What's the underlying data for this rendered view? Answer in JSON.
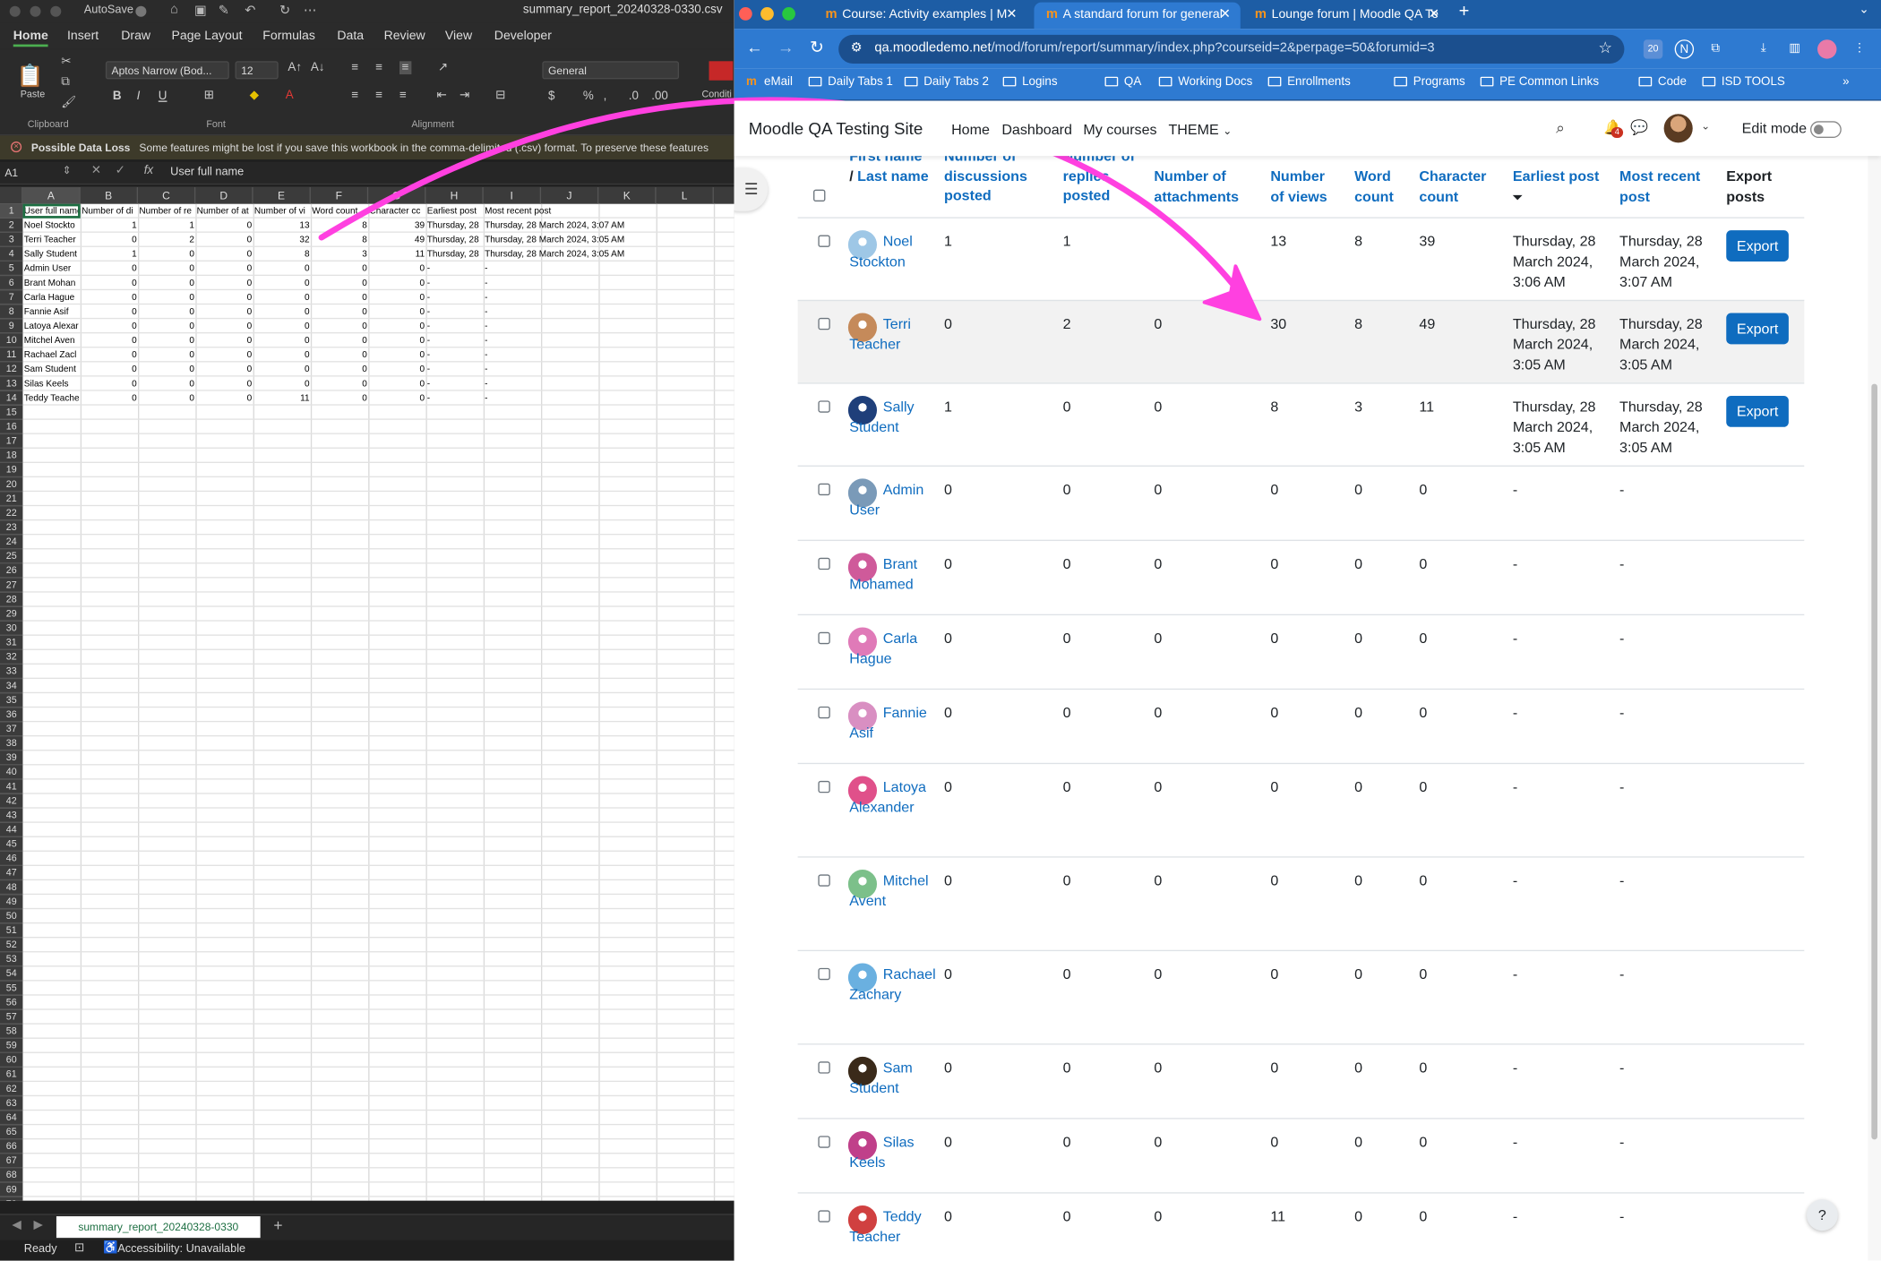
{
  "excel": {
    "autosave_label": "AutoSave",
    "filename": "summary_report_20240328-0330.csv",
    "ribbon_tabs": [
      "Home",
      "Insert",
      "Draw",
      "Page Layout",
      "Formulas",
      "Data",
      "Review",
      "View",
      "Developer"
    ],
    "font_name": "Aptos Narrow (Bod...",
    "font_size": "12",
    "number_format": "General",
    "paste_label": "Paste",
    "cond_label": "Conditi",
    "groups": {
      "clipboard": "Clipboard",
      "font": "Font",
      "alignment": "Alignment"
    },
    "alert_title": "Possible Data Loss",
    "alert_text": "Some features might be lost if you save this workbook in the comma-delimited (.csv) format. To preserve these features",
    "namebox": "A1",
    "formula": "User full name",
    "columns": [
      "A",
      "B",
      "C",
      "D",
      "E",
      "F",
      "G",
      "H",
      "I",
      "J",
      "K",
      "L"
    ],
    "header_row": [
      "User full name",
      "Number of di",
      "Number of re",
      "Number of at",
      "Number of vi",
      "Word count",
      "Character cc",
      "Earliest post",
      "Most recent post"
    ],
    "rows": [
      [
        "Noel Stockto",
        "1",
        "1",
        "0",
        "13",
        "8",
        "39",
        "Thursday, 28",
        "Thursday, 28 March 2024, 3:07 AM"
      ],
      [
        "Terri Teacher",
        "0",
        "2",
        "0",
        "32",
        "8",
        "49",
        "Thursday, 28",
        "Thursday, 28 March 2024, 3:05 AM"
      ],
      [
        "Sally Student",
        "1",
        "0",
        "0",
        "8",
        "3",
        "11",
        "Thursday, 28",
        "Thursday, 28 March 2024, 3:05 AM"
      ],
      [
        "Admin User",
        "0",
        "0",
        "0",
        "0",
        "0",
        "0",
        "-",
        "-"
      ],
      [
        "Brant Mohan",
        "0",
        "0",
        "0",
        "0",
        "0",
        "0",
        "-",
        "-"
      ],
      [
        "Carla Hague",
        "0",
        "0",
        "0",
        "0",
        "0",
        "0",
        "-",
        "-"
      ],
      [
        "Fannie Asif",
        "0",
        "0",
        "0",
        "0",
        "0",
        "0",
        "-",
        "-"
      ],
      [
        "Latoya Alexar",
        "0",
        "0",
        "0",
        "0",
        "0",
        "0",
        "-",
        "-"
      ],
      [
        "Mitchel Aven",
        "0",
        "0",
        "0",
        "0",
        "0",
        "0",
        "-",
        "-"
      ],
      [
        "Rachael Zacl",
        "0",
        "0",
        "0",
        "0",
        "0",
        "0",
        "-",
        "-"
      ],
      [
        "Sam Student",
        "0",
        "0",
        "0",
        "0",
        "0",
        "0",
        "-",
        "-"
      ],
      [
        "Silas Keels",
        "0",
        "0",
        "0",
        "0",
        "0",
        "0",
        "-",
        "-"
      ],
      [
        "Teddy Teache",
        "0",
        "0",
        "0",
        "11",
        "0",
        "0",
        "-",
        "-"
      ]
    ],
    "sheet_tab": "summary_report_20240328-0330",
    "status_ready": "Ready",
    "status_accessibility": "Accessibility: Unavailable"
  },
  "browser": {
    "tabs": [
      {
        "title": "Course: Activity examples | M"
      },
      {
        "title": "A standard forum for general"
      },
      {
        "title": "Lounge forum | Moodle QA Te"
      }
    ],
    "favicon_glyph": "m",
    "url_host": "qa.moodledemo.net",
    "url_path": "/mod/forum/report/summary/index.php?courseid=2&perpage=50&forumid=3",
    "ext_badge": "20",
    "bookmarks": [
      "eMail",
      "Daily Tabs 1",
      "Daily Tabs 2",
      "Logins",
      "QA",
      "Working Docs",
      "Enrollments",
      "Programs",
      "PE Common Links",
      "Code",
      "ISD TOOLS"
    ]
  },
  "moodle": {
    "site_name": "Moodle QA Testing Site",
    "nav": [
      "Home",
      "Dashboard",
      "My courses",
      "THEME"
    ],
    "notification_count": "4",
    "edit_mode_label": "Edit mode",
    "headers": {
      "first_name": "First name",
      "slash": "/ ",
      "last_name": "Last name",
      "discussions": "Number of discussions posted",
      "replies": "Number of replies posted",
      "attachments": "Number of attachments",
      "views": "Number of views",
      "words": "Word count",
      "chars": "Character count",
      "earliest": "Earliest post",
      "sort_indicator": "⏷",
      "recent": "Most recent post",
      "export": "Export posts"
    },
    "export_label": "Export",
    "help_label": "?",
    "rows": [
      {
        "name": "Noel Stockton",
        "discussions": "1",
        "replies": "1",
        "attachments": "",
        "views": "13",
        "words": "8",
        "chars": "39",
        "earliest": "Thursday, 28 March 2024, 3:06 AM",
        "recent": "Thursday, 28 March 2024, 3:07 AM",
        "export": true
      },
      {
        "name": "Terri Teacher",
        "discussions": "0",
        "replies": "2",
        "attachments": "0",
        "views": "30",
        "words": "8",
        "chars": "49",
        "earliest": "Thursday, 28 March 2024, 3:05 AM",
        "recent": "Thursday, 28 March 2024, 3:05 AM",
        "export": true
      },
      {
        "name": "Sally Student",
        "discussions": "1",
        "replies": "0",
        "attachments": "0",
        "views": "8",
        "words": "3",
        "chars": "11",
        "earliest": "Thursday, 28 March 2024, 3:05 AM",
        "recent": "Thursday, 28 March 2024, 3:05 AM",
        "export": true
      },
      {
        "name": "Admin User",
        "discussions": "0",
        "replies": "0",
        "attachments": "0",
        "views": "0",
        "words": "0",
        "chars": "0",
        "earliest": "-",
        "recent": "-",
        "export": false
      },
      {
        "name": "Brant Mohamed",
        "discussions": "0",
        "replies": "0",
        "attachments": "0",
        "views": "0",
        "words": "0",
        "chars": "0",
        "earliest": "-",
        "recent": "-",
        "export": false
      },
      {
        "name": "Carla Hague",
        "discussions": "0",
        "replies": "0",
        "attachments": "0",
        "views": "0",
        "words": "0",
        "chars": "0",
        "earliest": "-",
        "recent": "-",
        "export": false
      },
      {
        "name": "Fannie Asif",
        "discussions": "0",
        "replies": "0",
        "attachments": "0",
        "views": "0",
        "words": "0",
        "chars": "0",
        "earliest": "-",
        "recent": "-",
        "export": false
      },
      {
        "name": "Latoya Alexander",
        "discussions": "0",
        "replies": "0",
        "attachments": "0",
        "views": "0",
        "words": "0",
        "chars": "0",
        "earliest": "-",
        "recent": "-",
        "export": false
      },
      {
        "name": "Mitchel Avent",
        "discussions": "0",
        "replies": "0",
        "attachments": "0",
        "views": "0",
        "words": "0",
        "chars": "0",
        "earliest": "-",
        "recent": "-",
        "export": false
      },
      {
        "name": "Rachael Zachary",
        "discussions": "0",
        "replies": "0",
        "attachments": "0",
        "views": "0",
        "words": "0",
        "chars": "0",
        "earliest": "-",
        "recent": "-",
        "export": false
      },
      {
        "name": "Sam Student",
        "discussions": "0",
        "replies": "0",
        "attachments": "0",
        "views": "0",
        "words": "0",
        "chars": "0",
        "earliest": "-",
        "recent": "-",
        "export": false
      },
      {
        "name": "Silas Keels",
        "discussions": "0",
        "replies": "0",
        "attachments": "0",
        "views": "0",
        "words": "0",
        "chars": "0",
        "earliest": "-",
        "recent": "-",
        "export": false
      },
      {
        "name": "Teddy Teacher",
        "discussions": "0",
        "replies": "0",
        "attachments": "0",
        "views": "11",
        "words": "0",
        "chars": "0",
        "earliest": "-",
        "recent": "-",
        "export": false
      }
    ],
    "avatar_colors": [
      "#9ec7e6",
      "#c58a5a",
      "#1f3f7a",
      "#7a9ab8",
      "#cf5a9a",
      "#e07ab8",
      "#d98fc2",
      "#e0508a",
      "#7cc08a",
      "#6ab0e0",
      "#3a2a1a",
      "#c0408a",
      "#d04040"
    ]
  },
  "colors": {
    "moodle_blue": "#0f6cbf",
    "chrome_blue": "#2e7ad1",
    "annotation_pink": "#ff40e0"
  }
}
